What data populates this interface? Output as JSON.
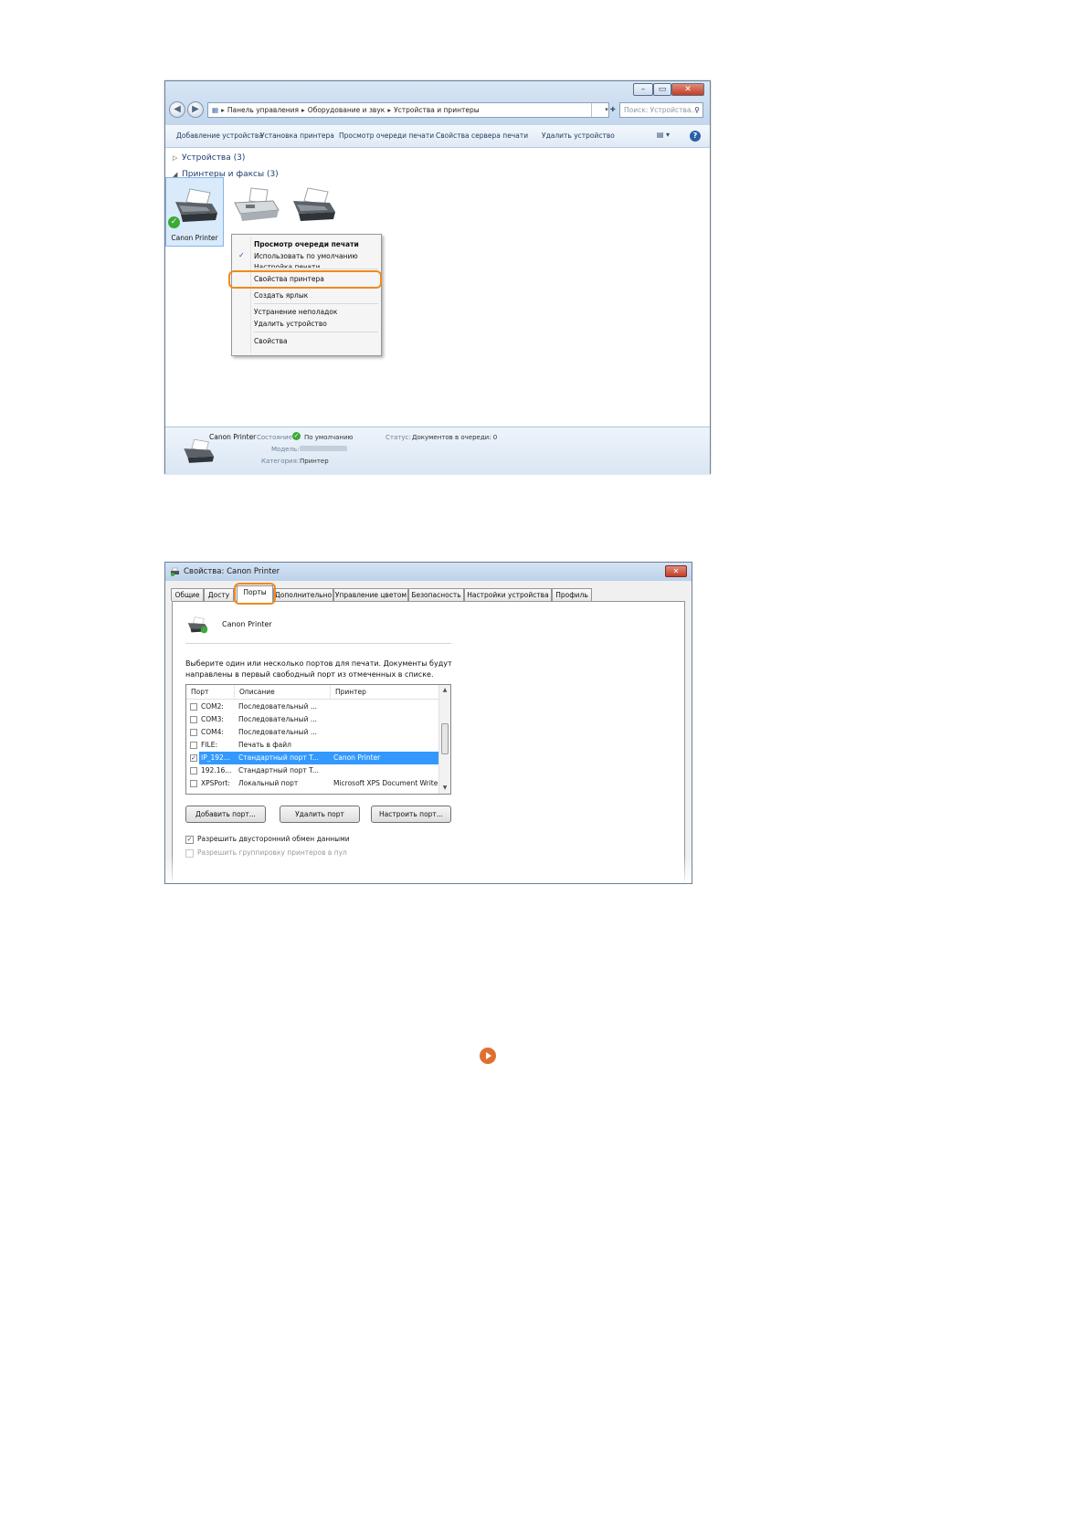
{
  "explorer": {
    "address": {
      "root_icon": "control-panel-icon",
      "crumbs": [
        "Панель управления",
        "Оборудование и звук",
        "Устройства и принтеры"
      ],
      "refresh": "▾  ✚"
    },
    "search_placeholder": "Поиск: Устройства...",
    "commands": [
      "Добавление устройства",
      "Установка принтера",
      "Просмотр очереди печати",
      "Свойства сервера печати",
      "Удалить устройство"
    ],
    "groups": {
      "devices": "Устройства (3)",
      "printers": "Принтеры и факсы (3)"
    },
    "printers": [
      {
        "label": "Canon Printer",
        "default": true,
        "icon": "printer-icon"
      },
      {
        "label": "",
        "default": false,
        "icon": "fax-icon"
      },
      {
        "label": "",
        "default": false,
        "icon": "printer-icon"
      }
    ],
    "context_menu": {
      "items": [
        "Просмотр очереди печати",
        "Использовать по умолчанию",
        "Настройка печати",
        "Свойства принтера",
        "Создать ярлык",
        "Устранение неполадок",
        "Удалить устройство",
        "Свойства"
      ],
      "highlighted": "Свойства принтера"
    },
    "details": {
      "name": "Canon Printer",
      "state_label": "Состояние:",
      "state_value": "По умолчанию",
      "status_label": "Статус:",
      "status_value": "Документов в очереди: 0",
      "model_label": "Модель:",
      "category_label": "Категория:",
      "category_value": "Принтер"
    }
  },
  "dialog": {
    "title": "Свойства: Canon Printer",
    "tabs": [
      "Общие",
      "Досту",
      "Порты",
      "Дополнительно",
      "Управление цветом",
      "Безопасность",
      "Настройки устройства",
      "Профиль"
    ],
    "active_tab": "Порты",
    "printer_name": "Canon Printer",
    "instruction_line1": "Выберите один или несколько портов для печати. Документы будут",
    "instruction_line2": "направлены в первый свободный порт из отмеченных в списке.",
    "columns": [
      "Порт",
      "Описание",
      "Принтер"
    ],
    "ports": [
      {
        "port": "COM2:",
        "desc": "Последовательный ...",
        "printer": "",
        "checked": false
      },
      {
        "port": "COM3:",
        "desc": "Последовательный ...",
        "printer": "",
        "checked": false
      },
      {
        "port": "COM4:",
        "desc": "Последовательный ...",
        "printer": "",
        "checked": false
      },
      {
        "port": "FILE:",
        "desc": "Печать в файл",
        "printer": "",
        "checked": false
      },
      {
        "port": "IP_192...",
        "desc": "Стандартный порт T...",
        "printer": "Canon Printer",
        "checked": true,
        "selected": true
      },
      {
        "port": "192.16...",
        "desc": "Стандартный порт T...",
        "printer": "",
        "checked": false
      },
      {
        "port": "XPSPort:",
        "desc": "Локальный порт",
        "printer": "Microsoft XPS Document Writer",
        "checked": false
      }
    ],
    "buttons": {
      "add": "Добавить порт...",
      "remove": "Удалить порт",
      "configure": "Настроить порт..."
    },
    "bidirectional": {
      "label": "Разрешить двусторонний обмен данными",
      "checked": true
    },
    "pooling": {
      "label": "Разрешить группировку принтеров в пул",
      "checked": false,
      "enabled": false
    }
  },
  "colors": {
    "highlight": "#ef8a1d",
    "selection": "#3399ff",
    "link_arrow": "#e06f32"
  }
}
